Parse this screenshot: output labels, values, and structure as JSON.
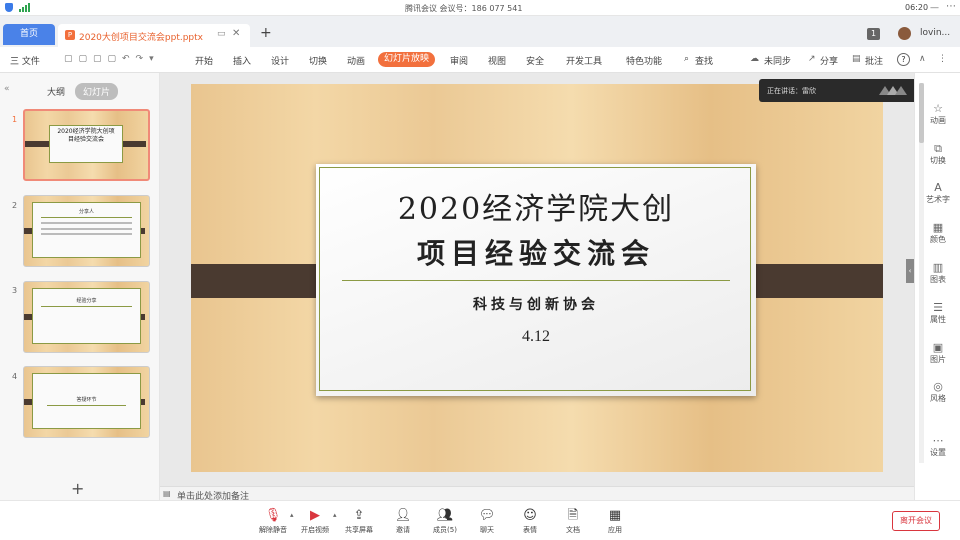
{
  "topbar": {
    "meeting_info": "腾讯会议 会议号：186 077 541",
    "time": "06:20"
  },
  "tabs": {
    "home": "首页",
    "file_tab": "2020大创项目交流会ppt.pptx",
    "add": "+",
    "badge": "1",
    "user": "lovin..."
  },
  "ribbon": {
    "file": "三 文件",
    "items": [
      "开始",
      "插入",
      "设计",
      "切换",
      "动画",
      "幻灯片放映",
      "审阅",
      "视图",
      "安全",
      "开发工具",
      "特色功能"
    ],
    "active": "幻灯片放映",
    "search": "查找",
    "sync": "未同步",
    "share": "分享",
    "comment": "批注",
    "help": "?"
  },
  "sidebar": {
    "tab_outline": "大纲",
    "tab_slides": "幻灯片",
    "add_slide": "+"
  },
  "slides": [
    {
      "num": "1",
      "title": "2020经济学院大创项目经验交流会"
    },
    {
      "num": "2",
      "title": "分享人"
    },
    {
      "num": "3",
      "title": "经验分享"
    },
    {
      "num": "4",
      "title": "答疑环节"
    }
  ],
  "main_slide": {
    "title_line1": "2020经济学院大创",
    "title_line2": "项目经验交流会",
    "subtitle": "科技与创新协会",
    "date": "4.12"
  },
  "notes_placeholder": "单击此处添加备注",
  "overlay": {
    "text": "正在讲话：雷欣"
  },
  "right_panel": [
    "动画",
    "切换",
    "艺术字",
    "颜色",
    "图表",
    "属性",
    "图片",
    "风格",
    "设置"
  ],
  "bottom_bar": {
    "buttons": [
      "解除静音",
      "开启视频",
      "共享屏幕",
      "邀请",
      "成员(5)",
      "聊天",
      "表情",
      "文档",
      "应用"
    ],
    "leave": "离开会议"
  },
  "colors": {
    "accent_orange": "#f2703d",
    "tab_blue": "#4a82e8",
    "leave_red": "#d9363e"
  }
}
